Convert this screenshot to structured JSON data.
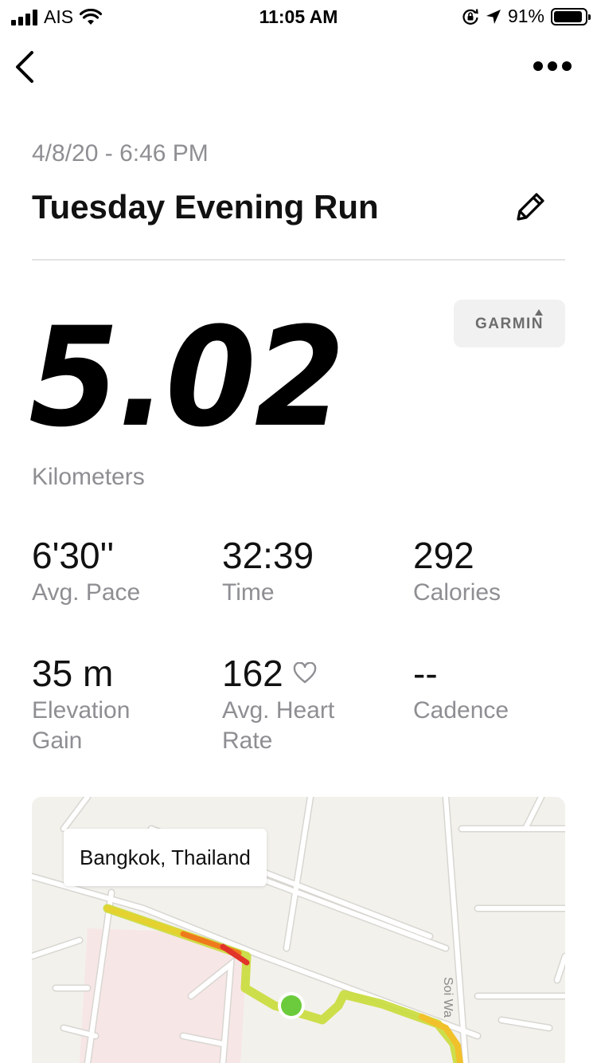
{
  "status_bar": {
    "carrier": "AIS",
    "time": "11:05 AM",
    "battery": "91%",
    "battery_level": 0.91
  },
  "nav": {
    "back_icon": "chevron-left-icon",
    "more_icon": "more-horizontal-icon"
  },
  "activity": {
    "date": "4/8/20 - 6:46 PM",
    "title": "Tuesday Evening Run",
    "source": "GARMIN",
    "distance": "5.02",
    "distance_unit": "Kilometers"
  },
  "stats": {
    "pace": {
      "value": "6'30''",
      "label": "Avg. Pace"
    },
    "time": {
      "value": "32:39",
      "label": "Time"
    },
    "calories": {
      "value": "292",
      "label": "Calories"
    },
    "elevation": {
      "value": "35 m",
      "label_line1": "Elevation",
      "label_line2": "Gain"
    },
    "heart_rate": {
      "value": "162",
      "label_line1": "Avg. Heart",
      "label_line2": "Rate"
    },
    "cadence": {
      "value": "--",
      "label": "Cadence"
    }
  },
  "map": {
    "location": "Bangkok, Thailand",
    "street_label": "Soi Wa"
  }
}
